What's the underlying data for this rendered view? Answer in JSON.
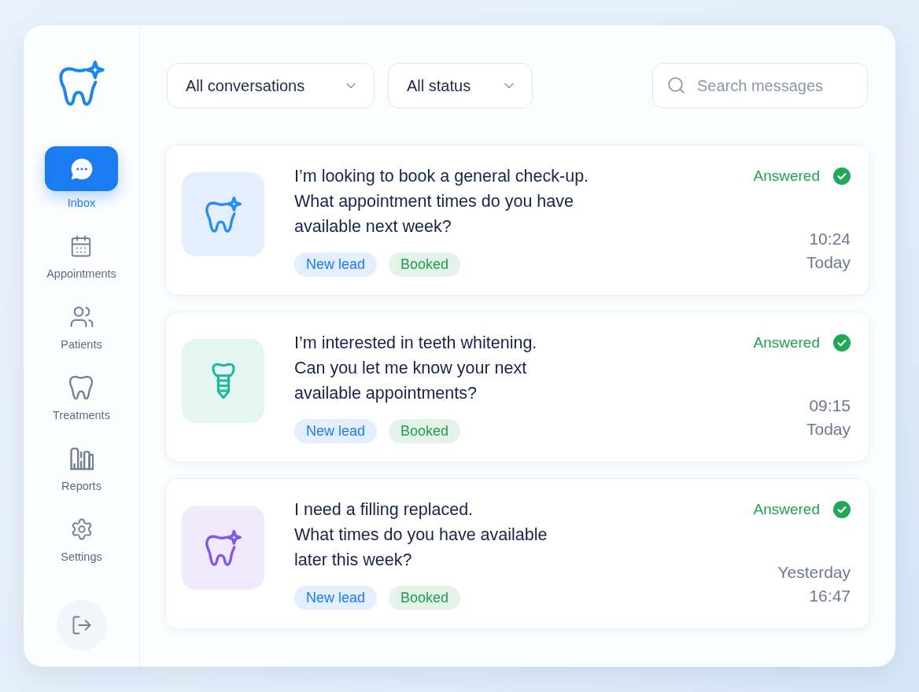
{
  "sidebar": {
    "items": [
      {
        "label": "Inbox",
        "selected": true
      },
      {
        "label": "Appointments",
        "selected": false
      },
      {
        "label": "Patients",
        "selected": false
      },
      {
        "label": "Treatments",
        "selected": false
      },
      {
        "label": "Reports",
        "selected": false
      },
      {
        "label": "Settings",
        "selected": false
      }
    ]
  },
  "filters": [
    {
      "value": "All conversations"
    },
    {
      "value": "All status"
    }
  ],
  "search": {
    "placeholder": "Search messages"
  },
  "conversations": [
    {
      "message": [
        "I’m looking to book a general check-up.",
        "What appointment times do you have",
        "available next week?"
      ],
      "tags": [
        {
          "label": "New lead",
          "color": "#1a7cf0"
        },
        {
          "label": "Booked",
          "color": "#1f9d4c"
        }
      ],
      "status": "Answered",
      "timestamp": [
        "10:24",
        "Today"
      ]
    },
    {
      "message": [
        "I’m interested in teeth whitening.",
        "Can you let me know your next",
        "available appointments?"
      ],
      "tags": [
        {
          "label": "New lead",
          "color": "#1a7cf0"
        },
        {
          "label": "Booked",
          "color": "#1f9d4c"
        }
      ],
      "status": "Answered",
      "timestamp": [
        "09:15",
        "Today"
      ]
    },
    {
      "message": [
        "I need a filling replaced.",
        "What times do you have available",
        "later this week?"
      ],
      "tags": [
        {
          "label": "New lead",
          "color": "#1a7cf0"
        },
        {
          "label": "Booked",
          "color": "#1f9d4c"
        }
      ],
      "status": "Answered",
      "timestamp": [
        "Yesterday",
        "16:47"
      ]
    }
  ]
}
